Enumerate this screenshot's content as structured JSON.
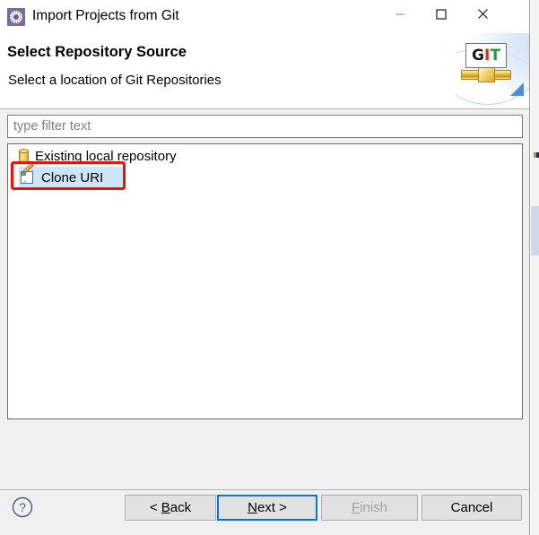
{
  "window": {
    "title": "Import Projects from Git",
    "app_icon": "gear-icon",
    "controls": {
      "minimize": "minimize-icon",
      "maximize": "maximize-icon",
      "close": "close-icon"
    }
  },
  "header": {
    "title": "Select Repository Source",
    "description": "Select a location of Git Repositories",
    "logo": {
      "letter_g": "G",
      "letter_i": "I",
      "letter_t": "T",
      "color_g": "#1a1a1a",
      "color_i": "#d42a20",
      "color_t": "#1f9c2f"
    }
  },
  "filter": {
    "value": "",
    "placeholder": "type filter text"
  },
  "tree": {
    "items": [
      {
        "label": "Existing local repository",
        "icon": "repository-icon",
        "selected": false
      },
      {
        "label": "Clone URI",
        "icon": "clone-uri-icon",
        "selected": true
      }
    ],
    "selection_color": "#cde6f7"
  },
  "annotation": {
    "target": "Clone URI",
    "color": "#fa0c06"
  },
  "footer": {
    "help": "?",
    "buttons": [
      {
        "id": "back",
        "label": "< Back",
        "accel": "B",
        "enabled": true,
        "focused": false
      },
      {
        "id": "next",
        "label": "Next >",
        "accel": "N",
        "enabled": true,
        "focused": true
      },
      {
        "id": "finish",
        "label": "Finish",
        "accel": "F",
        "enabled": false,
        "focused": false
      },
      {
        "id": "cancel",
        "label": "Cancel",
        "accel": "",
        "enabled": true,
        "focused": false
      }
    ],
    "focus_color": "#0a74d0"
  }
}
